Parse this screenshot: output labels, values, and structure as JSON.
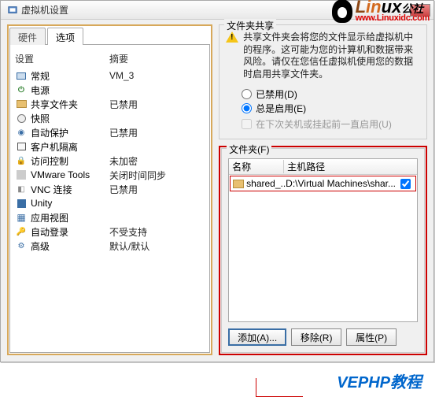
{
  "window": {
    "title": "虚拟机设置"
  },
  "tabs": {
    "hardware": "硬件",
    "options": "选项"
  },
  "list_header": {
    "setting": "设置",
    "summary": "摘要"
  },
  "options": [
    {
      "icon": "monitor",
      "name": "常规",
      "value": "VM_3"
    },
    {
      "icon": "power",
      "name": "电源",
      "value": ""
    },
    {
      "icon": "folder",
      "name": "共享文件夹",
      "value": "已禁用"
    },
    {
      "icon": "snap",
      "name": "快照",
      "value": ""
    },
    {
      "icon": "shield",
      "name": "自动保护",
      "value": "已禁用"
    },
    {
      "icon": "guest",
      "name": "客户机隔离",
      "value": ""
    },
    {
      "icon": "lock",
      "name": "访问控制",
      "value": "未加密"
    },
    {
      "icon": "vmt",
      "name": "VMware Tools",
      "value": "关闭时间同步"
    },
    {
      "icon": "vnc",
      "name": "VNC 连接",
      "value": "已禁用"
    },
    {
      "icon": "unity",
      "name": "Unity",
      "value": ""
    },
    {
      "icon": "appv",
      "name": "应用视图",
      "value": ""
    },
    {
      "icon": "auto",
      "name": "自动登录",
      "value": "不受支持"
    },
    {
      "icon": "adv",
      "name": "高级",
      "value": "默认/默认"
    }
  ],
  "share": {
    "group_title": "文件夹共享",
    "warning": "共享文件夹会将您的文件显示给虚拟机中的程序。这可能为您的计算机和数据带来风险。请仅在您信任虚拟机使用您的数据时启用共享文件夹。",
    "opt_disabled": "已禁用(D)",
    "opt_enabled": "总是启用(E)",
    "opt_next": "在下次关机或挂起前一直启用(U)",
    "selected": "enabled"
  },
  "folders": {
    "group_title": "文件夹(F)",
    "col_name": "名称",
    "col_path": "主机路径",
    "rows": [
      {
        "name": "shared_...",
        "path": "D:\\Virtual Machines\\shar...",
        "checked": true
      }
    ],
    "btn_add": "添加(A)...",
    "btn_remove": "移除(R)",
    "btn_props": "属性(P)"
  },
  "logo": {
    "main": "Linux",
    "sub_hz": "公社",
    "url": "www.Linuxidc.com"
  },
  "footer": "VEPHP教程"
}
